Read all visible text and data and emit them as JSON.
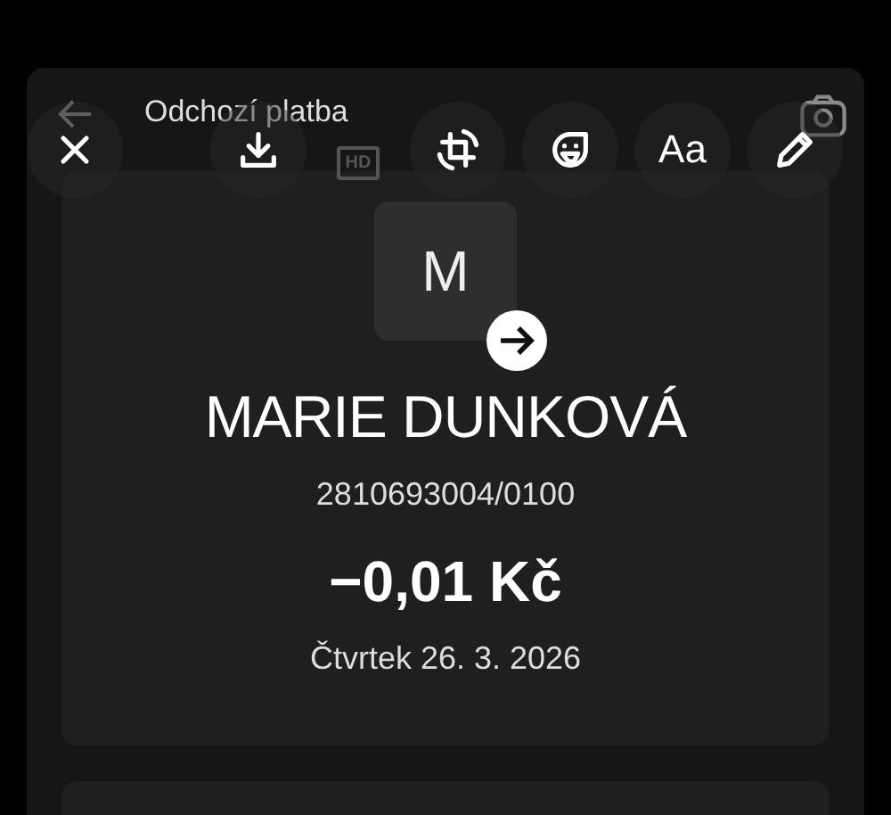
{
  "header": {
    "title": "Odchozí platba"
  },
  "editor_tools": [
    {
      "kind": "close"
    },
    {
      "kind": "download"
    },
    {
      "kind": "hd",
      "label": "HD"
    },
    {
      "kind": "rotate"
    },
    {
      "kind": "sticker"
    },
    {
      "kind": "text",
      "label": "Aa"
    },
    {
      "kind": "draw"
    }
  ],
  "payment": {
    "avatar_letter": "M",
    "name": "MARIE DUNKOVÁ",
    "account": "2810693004/0100",
    "amount": "−0,01 Kč",
    "date": "Čtvrtek 26. 3. 2026"
  }
}
